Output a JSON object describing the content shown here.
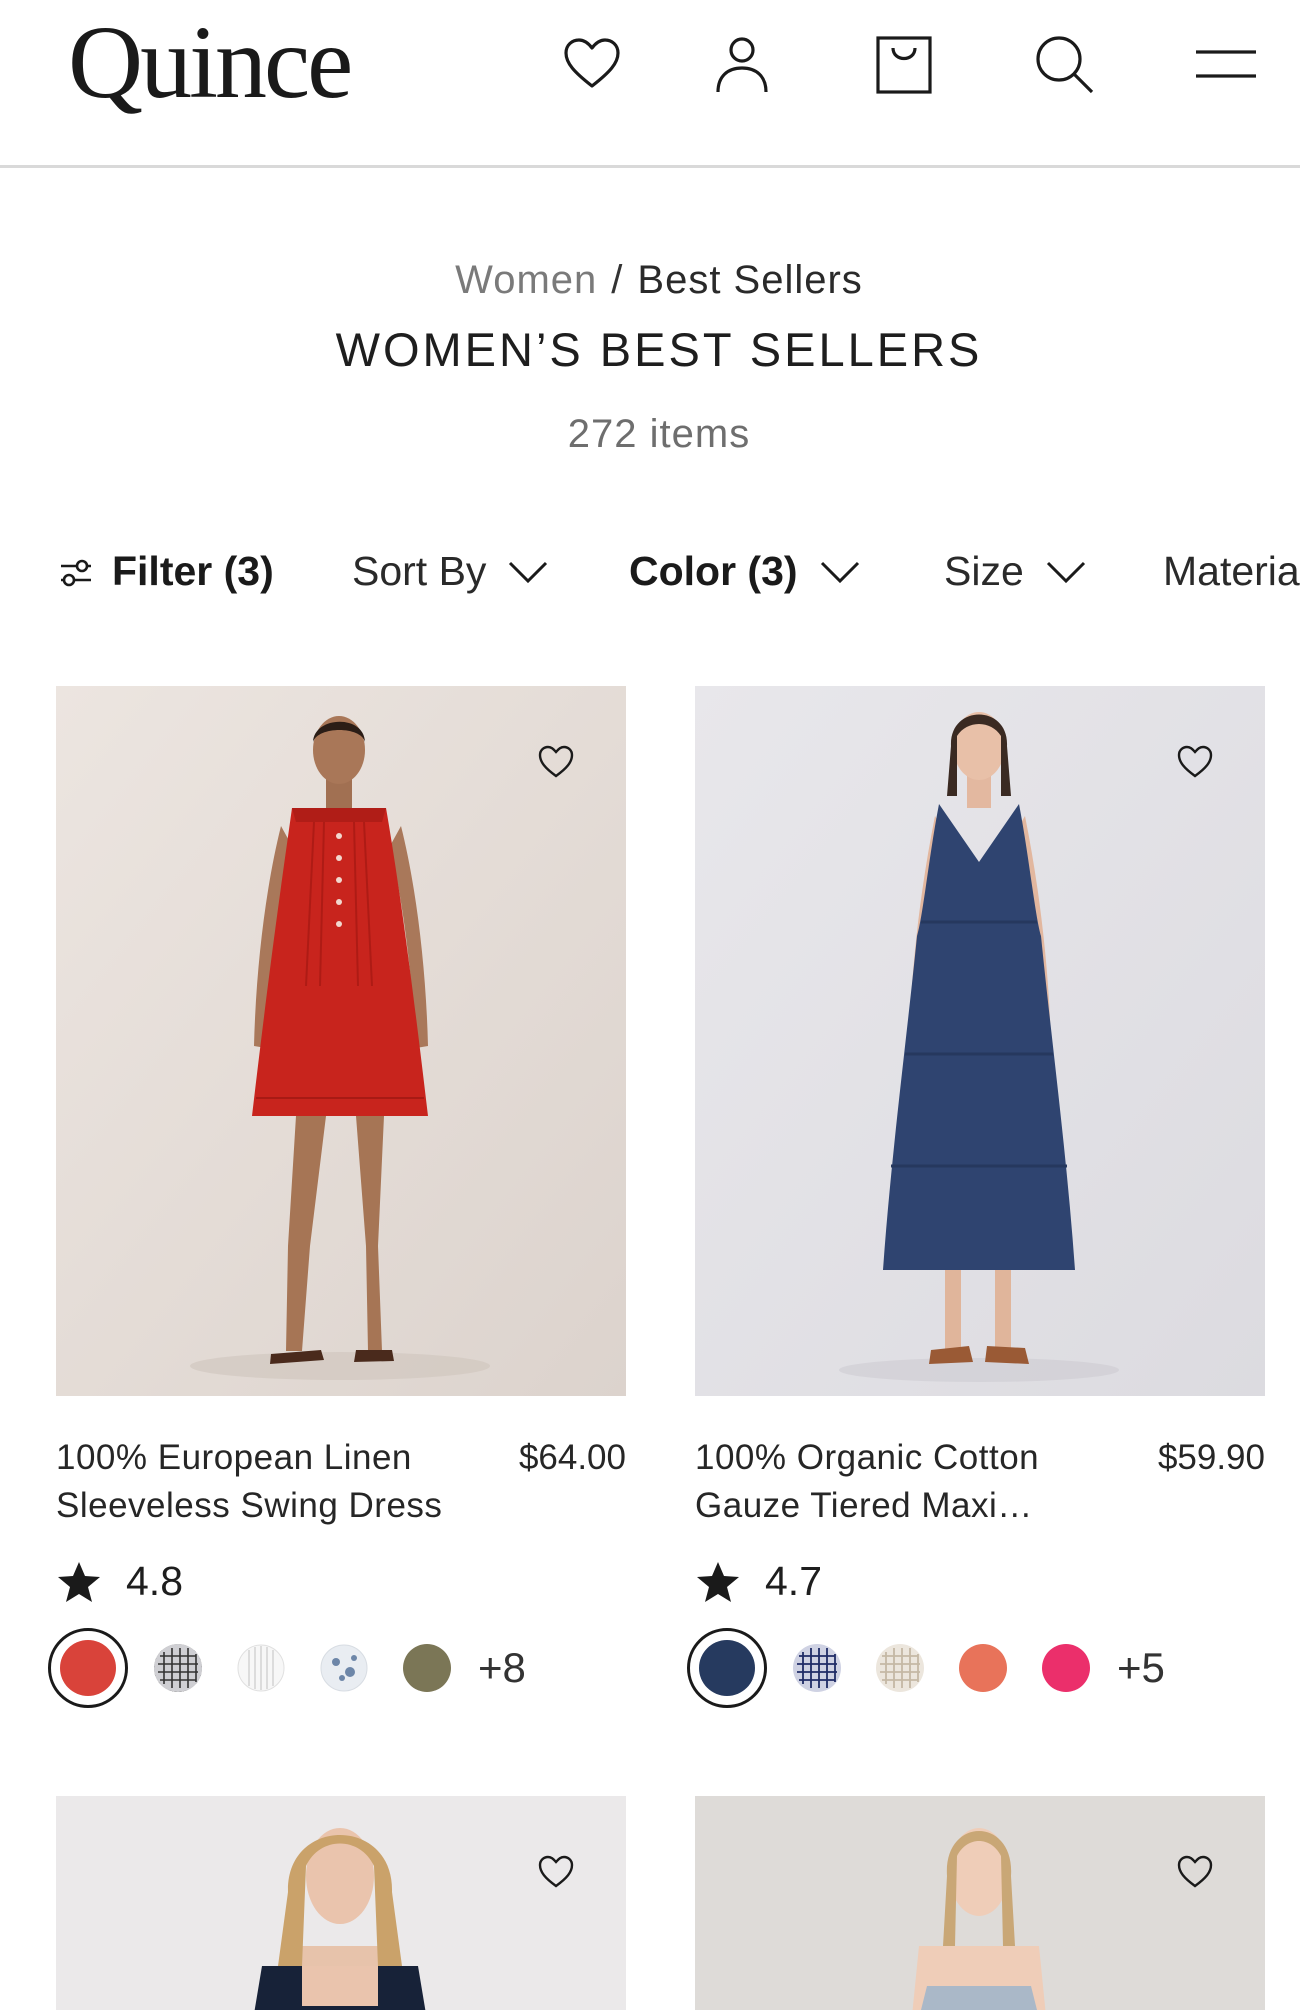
{
  "header": {
    "logo": "Quince",
    "icons": [
      "heart-icon",
      "account-icon",
      "shopping-bag-icon",
      "search-icon",
      "menu-icon"
    ]
  },
  "breadcrumb": {
    "parent": "Women",
    "separator": "/",
    "current": "Best Sellers"
  },
  "page": {
    "title": "WOMEN’S BEST SELLERS",
    "count": "272 items"
  },
  "filters": {
    "filter": "Filter (3)",
    "sort": "Sort By",
    "color": "Color (3)",
    "size": "Size",
    "material": "Materia"
  },
  "products": [
    {
      "name": "100% European Linen Sleeveless Swing Dress",
      "price": "$64.00",
      "rating": "4.8",
      "swatch_colors": [
        "#d9433a",
        "grid",
        "stripe",
        "floral",
        "#7b7656"
      ],
      "more": "+8",
      "dress_color": "#c8241d",
      "bg_color": "#e7dfda"
    },
    {
      "name": "100% Organic Cotton Gauze Tiered Maxi…",
      "price": "$59.90",
      "rating": "4.7",
      "swatch_colors": [
        "#263a5f",
        "navy-grid",
        "beige-grid",
        "#e8735a",
        "#eb2f6b"
      ],
      "more": "+5",
      "dress_color": "#2f4470",
      "bg_color": "#e3e2e6"
    }
  ]
}
